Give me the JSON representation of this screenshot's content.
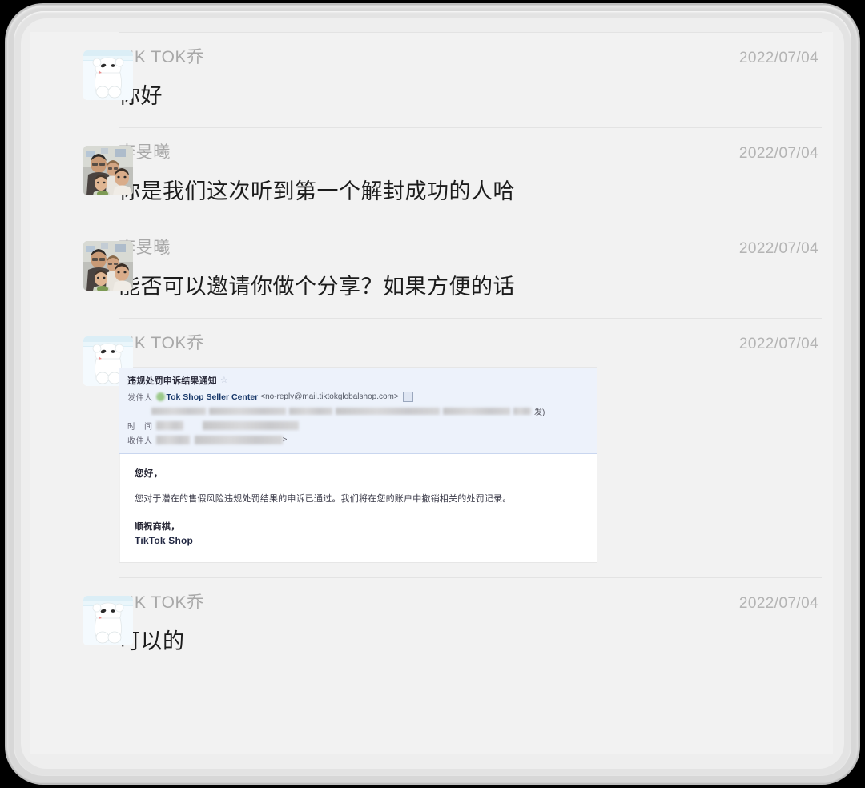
{
  "conversation": {
    "messages": [
      {
        "id": "msg-1",
        "sender": "TIK TOK乔",
        "timestamp": "2022/07/04",
        "avatar": "ice-bear-avatar",
        "type": "text",
        "text": "你好"
      },
      {
        "id": "msg-2",
        "sender": "李旻曦",
        "timestamp": "2022/07/04",
        "avatar": "family-photo-avatar",
        "type": "text",
        "text": "你是我们这次听到第一个解封成功的人哈"
      },
      {
        "id": "msg-3",
        "sender": "李旻曦",
        "timestamp": "2022/07/04",
        "avatar": "family-photo-avatar",
        "type": "text",
        "text": "能否可以邀请你做个分享？如果方便的话"
      },
      {
        "id": "msg-4",
        "sender": "TIK TOK乔",
        "timestamp": "2022/07/04",
        "avatar": "ice-bear-avatar",
        "type": "image",
        "text": ""
      },
      {
        "id": "msg-5",
        "sender": "TIK TOK乔",
        "timestamp": "2022/07/04",
        "avatar": "ice-bear-avatar",
        "type": "text",
        "text": "可以的"
      }
    ]
  },
  "email_screenshot": {
    "subject": "违规处罚申诉结果通知",
    "star_glyph": "☆",
    "fields": {
      "sender_label": "发件人",
      "sender_name": "Tok Shop Seller Center",
      "sender_address": "<no-reply@mail.tiktokglobalshop.com>",
      "sent_suffix": "发)",
      "time_label": "时　间",
      "recipient_label": "收件人",
      "recipient_redacted_tail": ">"
    },
    "body": {
      "greeting": "您好，",
      "paragraph": "您对于潜在的售假风险违规处罚结果的申诉已通过。我们将在您的账户中撤销相关的处罚记录。",
      "signoff": "顺祝商祺，",
      "brand": "TikTok Shop"
    }
  },
  "colors": {
    "panel_background": "#f2f2f2",
    "bezel": "#d7d7d7",
    "divider": "#e3e3e3",
    "sender_text": "#a8a8a8",
    "timestamp_text": "#b4b4b4",
    "message_text": "#1c1c1c",
    "email_header_background": "#edf2fb",
    "email_brand_text": "#1f2540"
  }
}
